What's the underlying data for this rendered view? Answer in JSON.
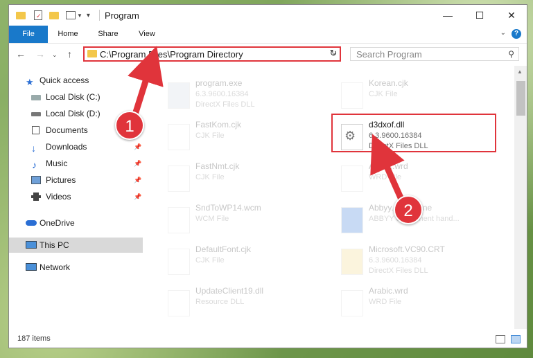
{
  "window": {
    "title": "Program"
  },
  "ribbon": {
    "tabs": [
      "File",
      "Home",
      "Share",
      "View"
    ],
    "help": "?"
  },
  "address": {
    "path": "C:\\Program Files\\Program Directory"
  },
  "search": {
    "placeholder": "Search Program"
  },
  "sidebar": {
    "items": [
      {
        "label": "Quick access",
        "icon": "star-icon",
        "color": "#2a6ed4"
      },
      {
        "label": "Local Disk (C:)",
        "icon": "drive-icon",
        "pin": false
      },
      {
        "label": "Local Disk (D:)",
        "icon": "drive-icon"
      },
      {
        "label": "Documents",
        "icon": "document-icon"
      },
      {
        "label": "Downloads",
        "icon": "download-icon",
        "pin": true
      },
      {
        "label": "Music",
        "icon": "music-icon",
        "pin": true
      },
      {
        "label": "Pictures",
        "icon": "picture-icon",
        "pin": true
      },
      {
        "label": "Videos",
        "icon": "video-icon",
        "pin": true
      },
      {
        "label": "OneDrive",
        "icon": "cloud-icon"
      },
      {
        "label": "This PC",
        "icon": "computer-icon",
        "selected": true
      },
      {
        "label": "Network",
        "icon": "network-icon"
      }
    ]
  },
  "files": {
    "left": [
      {
        "name": "program.exe",
        "line2": "6.3.9600.16384",
        "line3": "DirectX Files DLL"
      },
      {
        "name": "FastKom.cjk",
        "line2": "CJK File"
      },
      {
        "name": "FastNmt.cjk",
        "line2": "CJK File"
      },
      {
        "name": "SndToWP14.wcm",
        "line2": "WCM File"
      },
      {
        "name": "DefaultFont.cjk",
        "line2": "CJK File"
      },
      {
        "name": "UpdateClient19.dll",
        "line2": "Resource DLL"
      }
    ],
    "right": [
      {
        "name": "Korean.cjk",
        "line2": "CJK File"
      },
      {
        "name": "d3dxof.dll",
        "line2": "6.3.9600.16384",
        "line3": "DirectX Files DLL"
      },
      {
        "name": "Arabic.wrd",
        "line2": "WRD File"
      },
      {
        "name": "Abbyy.ocr.engine",
        "line2": "ABBYY component hand..."
      },
      {
        "name": "Microsoft.VC90.CRT",
        "line2": "6.3.9600.16384",
        "line3": "DirectX Files DLL"
      },
      {
        "name": "Arabic.wrd",
        "line2": "WRD File"
      }
    ]
  },
  "status": {
    "count": "187 items"
  },
  "annotations": {
    "step1": "1",
    "step2": "2",
    "color": "#e0343b"
  }
}
